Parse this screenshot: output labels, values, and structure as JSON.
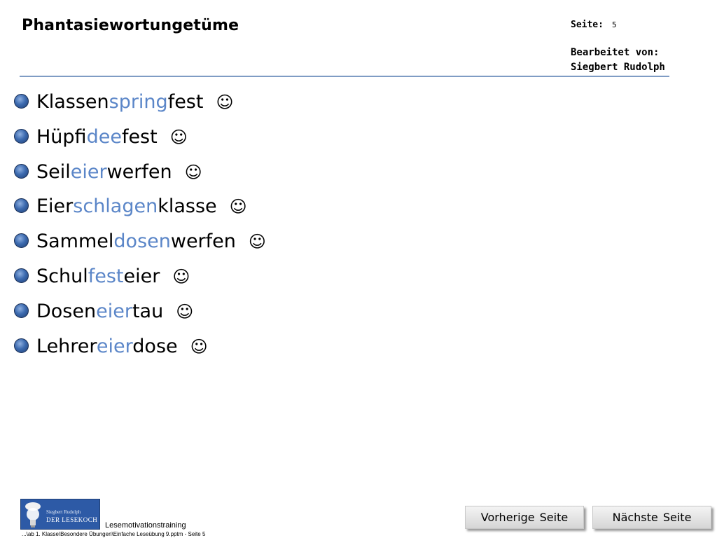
{
  "header": {
    "title": "Phantasiewortungetüme",
    "page_label": "Seite:",
    "page_number": "5",
    "edited_label": "Bearbeitet von:",
    "edited_name": "Siegbert Rudolph"
  },
  "words": [
    {
      "pre": "Klassen",
      "hl": "spring",
      "post": "fest",
      "smiley": "☺"
    },
    {
      "pre": "Hüpf",
      "hl": "idee",
      "post": "fest",
      "smiley": "☺"
    },
    {
      "pre": "Seil",
      "hl": "eier",
      "post": "werfen",
      "smiley": "☺"
    },
    {
      "pre": "Eier",
      "hl": "schlagen",
      "post": "klasse",
      "smiley": "☺"
    },
    {
      "pre": "Sammel",
      "hl": "dosen",
      "post": "werfen",
      "smiley": "☺"
    },
    {
      "pre": "Schul",
      "hl": "fest",
      "post": "eier",
      "smiley": "☺"
    },
    {
      "pre": "Dosen",
      "hl": "eier",
      "post": "tau",
      "smiley": "☺"
    },
    {
      "pre": "Lehrer",
      "hl": "eier",
      "post": "dose",
      "smiley": "☺"
    }
  ],
  "footer": {
    "logo_name": "Siegbert Rudolph",
    "logo_brand_1": "DER",
    "logo_brand_2": "LESEKOCH",
    "caption": "Lesemotivationstraining",
    "path": "...\\ab 1. Klasse\\Besondere Übungen\\Einfache Leseübung 9.pptm - Seite 5"
  },
  "nav": {
    "prev_label": "Vorherige Seite",
    "next_label": "Nächste Seite"
  },
  "colors": {
    "highlight": "#5b86c8",
    "rule": "#7f9cc4",
    "logo_bg": "#2d5aa6"
  },
  "icons": {
    "bullet": "bullet-circle-icon",
    "smiley": "smiley-icon",
    "logo": "lightbulb-chef-icon"
  }
}
